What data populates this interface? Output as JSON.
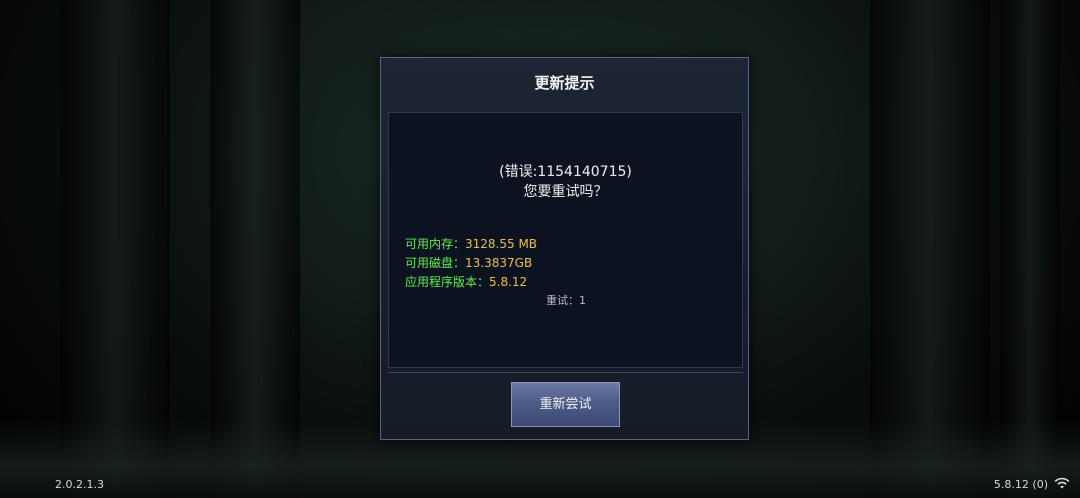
{
  "dialog": {
    "title": "更新提示",
    "error_text": "(错误:1154140715)",
    "question_text": "您要重试吗？",
    "info": [
      {
        "label": "可用内存：",
        "value": "3128.55 MB"
      },
      {
        "label": "可用磁盘：",
        "value": "13.3837GB"
      },
      {
        "label": "应用程序版本：",
        "value": "5.8.12"
      }
    ],
    "retry_count": "重试：1",
    "button_label": "重新尝试"
  },
  "footer": {
    "left_version": "2.0.2.1.3",
    "right_version": "5.8.12 (0)",
    "wifi_icon": "wifi-icon"
  },
  "colors": {
    "label_green": "#5cf04a",
    "value_yellow": "#e8c048",
    "dialog_bg": "#1d2433",
    "button_blue": "#4b5a86"
  }
}
